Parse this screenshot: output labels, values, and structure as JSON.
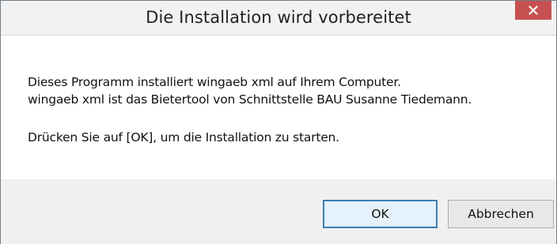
{
  "dialog": {
    "title": "Die Installation wird vorbereitet",
    "close_icon": "close-icon",
    "message_lines": [
      "Dieses Programm installiert wingaeb xml auf Ihrem Computer.",
      "wingaeb xml ist das Bietertool von Schnittstelle BAU Susanne Tiedemann.",
      "Drücken Sie auf [OK], um die Installation zu starten."
    ],
    "buttons": {
      "ok_label": "OK",
      "cancel_label": "Abbrechen"
    }
  },
  "colors": {
    "close_button": "#c75050",
    "default_button_border": "#3c7fb1",
    "footer_background": "#f0f0f0"
  }
}
